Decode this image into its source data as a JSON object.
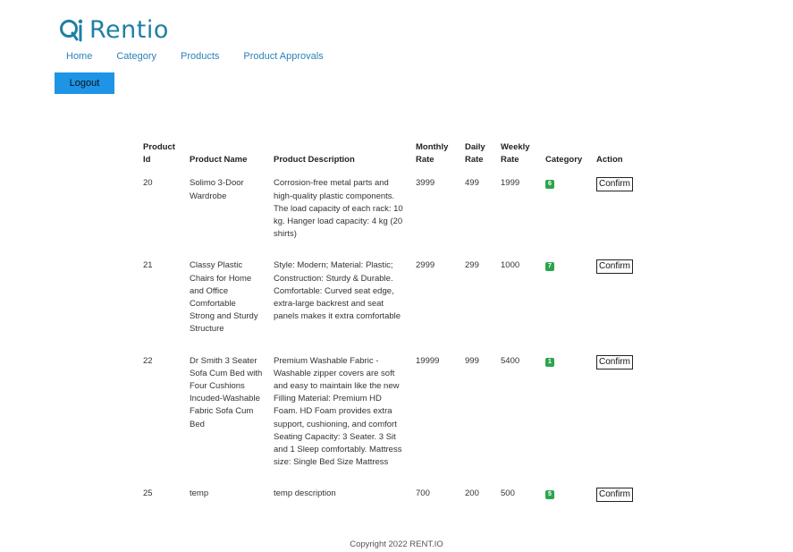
{
  "brand": {
    "name": "Rentio",
    "logo_icon": "rentio-logo-icon",
    "color": "#1e7fa3"
  },
  "nav": [
    {
      "label": "Home"
    },
    {
      "label": "Category"
    },
    {
      "label": "Products"
    },
    {
      "label": "Product Approvals"
    }
  ],
  "logout_label": "Logout",
  "table": {
    "headers": {
      "id": "Product Id",
      "name": "Product Name",
      "desc": "Product Description",
      "monthly": "Monthly Rate",
      "daily": "Daily Rate",
      "weekly": "Weekly Rate",
      "category": "Category",
      "action": "Action"
    },
    "rows": [
      {
        "id": "20",
        "name": "Solimo 3-Door Wardrobe",
        "desc": "Corrosion-free metal parts and high-quality plastic components. The load capacity of each rack: 10 kg. Hanger load capacity: 4 kg (20 shirts)",
        "monthly": "3999",
        "daily": "499",
        "weekly": "1999",
        "category": "6",
        "action": "Confirm"
      },
      {
        "id": "21",
        "name": "Classy Plastic Chairs for Home and Office Comfortable Strong and Sturdy Structure",
        "desc": "Style: Modern; Material: Plastic; Construction: Sturdy & Durable. Comfortable: Curved seat edge, extra-large backrest and seat panels makes it extra comfortable",
        "monthly": "2999",
        "daily": "299",
        "weekly": "1000",
        "category": "7",
        "action": "Confirm"
      },
      {
        "id": "22",
        "name": "Dr Smith 3 Seater Sofa Cum Bed with Four Cushions Incuded-Washable Fabric Sofa Cum Bed",
        "desc": "Premium Washable Fabric - Washable zipper covers are soft and easy to maintain like the new Filling Material: Premium HD Foam. HD Foam provides extra support, cushioning, and comfort Seating Capacity: 3 Seater. 3 Sit and 1 Sleep comfortably. Mattress size: Single Bed Size Mattress",
        "monthly": "19999",
        "daily": "999",
        "weekly": "5400",
        "category": "1",
        "action": "Confirm"
      },
      {
        "id": "25",
        "name": "temp",
        "desc": "temp description",
        "monthly": "700",
        "daily": "200",
        "weekly": "500",
        "category": "5",
        "action": "Confirm"
      }
    ]
  },
  "footer": "Copyright 2022 RENT.IO",
  "colors": {
    "nav_link": "#2a80b9",
    "logout_bg": "#1e94e6",
    "badge": "#2ea44f"
  }
}
